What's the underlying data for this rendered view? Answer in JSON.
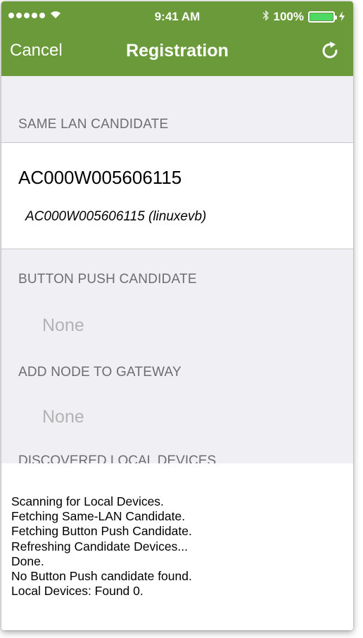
{
  "status_bar": {
    "time": "9:41 AM",
    "battery_percent": "100%"
  },
  "nav": {
    "cancel_label": "Cancel",
    "title": "Registration"
  },
  "sections": {
    "same_lan": {
      "header": "SAME LAN CANDIDATE",
      "device_title": "AC000W005606115",
      "device_subtitle": "AC000W005606115 (linuxevb)"
    },
    "button_push": {
      "header": "BUTTON PUSH CANDIDATE",
      "value": "None"
    },
    "add_node": {
      "header": "ADD NODE TO GATEWAY",
      "value": "None"
    },
    "discovered": {
      "header": "DISCOVERED LOCAL DEVICES"
    }
  },
  "log": [
    "Scanning for Local Devices.",
    "Fetching Same-LAN Candidate.",
    "Fetching Button Push Candidate.",
    "Refreshing Candidate Devices...",
    "Done.",
    "No Button Push candidate found.",
    "Local Devices: Found 0."
  ],
  "colors": {
    "nav_background": "#6a9a3a",
    "battery_fill": "#4ed964",
    "placeholder_text": "#b3b3b3"
  },
  "icons": [
    "cellular-signal-icon",
    "wifi-icon",
    "bluetooth-icon",
    "battery-icon",
    "charging-icon",
    "refresh-icon"
  ]
}
